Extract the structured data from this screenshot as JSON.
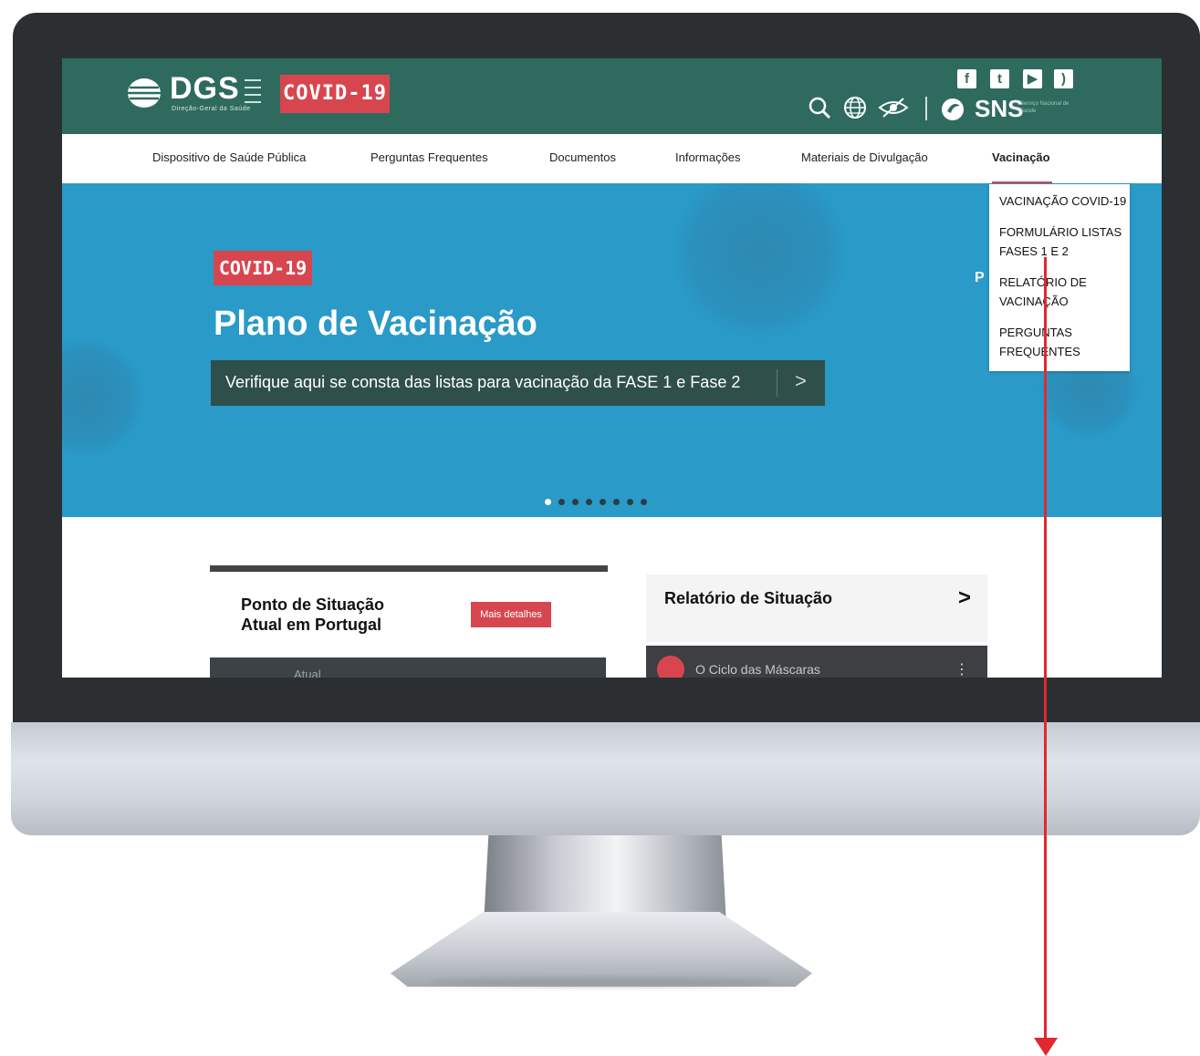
{
  "header": {
    "logo_text": "DGS",
    "logo_subtitle": "Direção-Geral da Saúde",
    "covid_badge": "COVID-19",
    "social_icons": [
      "facebook-icon",
      "twitter-icon",
      "youtube-icon",
      "rss-icon"
    ],
    "tool_icons": [
      "search-icon",
      "globe-icon",
      "accessibility-eye-icon"
    ],
    "sns_label": "SNS",
    "sns_subtitle": "Serviço Nacional de Saúde"
  },
  "nav": {
    "items": [
      "Dispositivo de Saúde Pública",
      "Perguntas Frequentes",
      "Documentos",
      "Informações",
      "Materiais de Divulgação",
      "Vacinação"
    ],
    "active_index": 5
  },
  "dropdown": {
    "items": [
      "VACINAÇÃO COVID-19",
      "FORMULÁRIO LISTAS FASES 1 E 2",
      "RELATÓRIO DE VACINAÇÃO",
      "PERGUNTAS FREQUENTES"
    ]
  },
  "hero": {
    "badge": "COVID-19",
    "title": "Plano de Vacinação",
    "cta_text": "Verifique aqui se consta das listas para vacinação da FASE 1  e Fase 2",
    "cta_chevron": ">",
    "side_letters": "P",
    "carousel_dots": 8,
    "carousel_active": 0
  },
  "situacao": {
    "title": "Ponto de Situação Atual em Portugal",
    "button": "Mais detalhes",
    "bottom_text": "Atual"
  },
  "relatorio": {
    "title": "Relatório de Situação",
    "chevron": ">"
  },
  "video": {
    "title": "O Ciclo das Máscaras",
    "menu": "⋮"
  },
  "colors": {
    "header_green": "#2e6b5e",
    "accent_red": "#d7464f",
    "hero_blue": "#2a9ac8",
    "annotation_red": "#e0282e"
  }
}
